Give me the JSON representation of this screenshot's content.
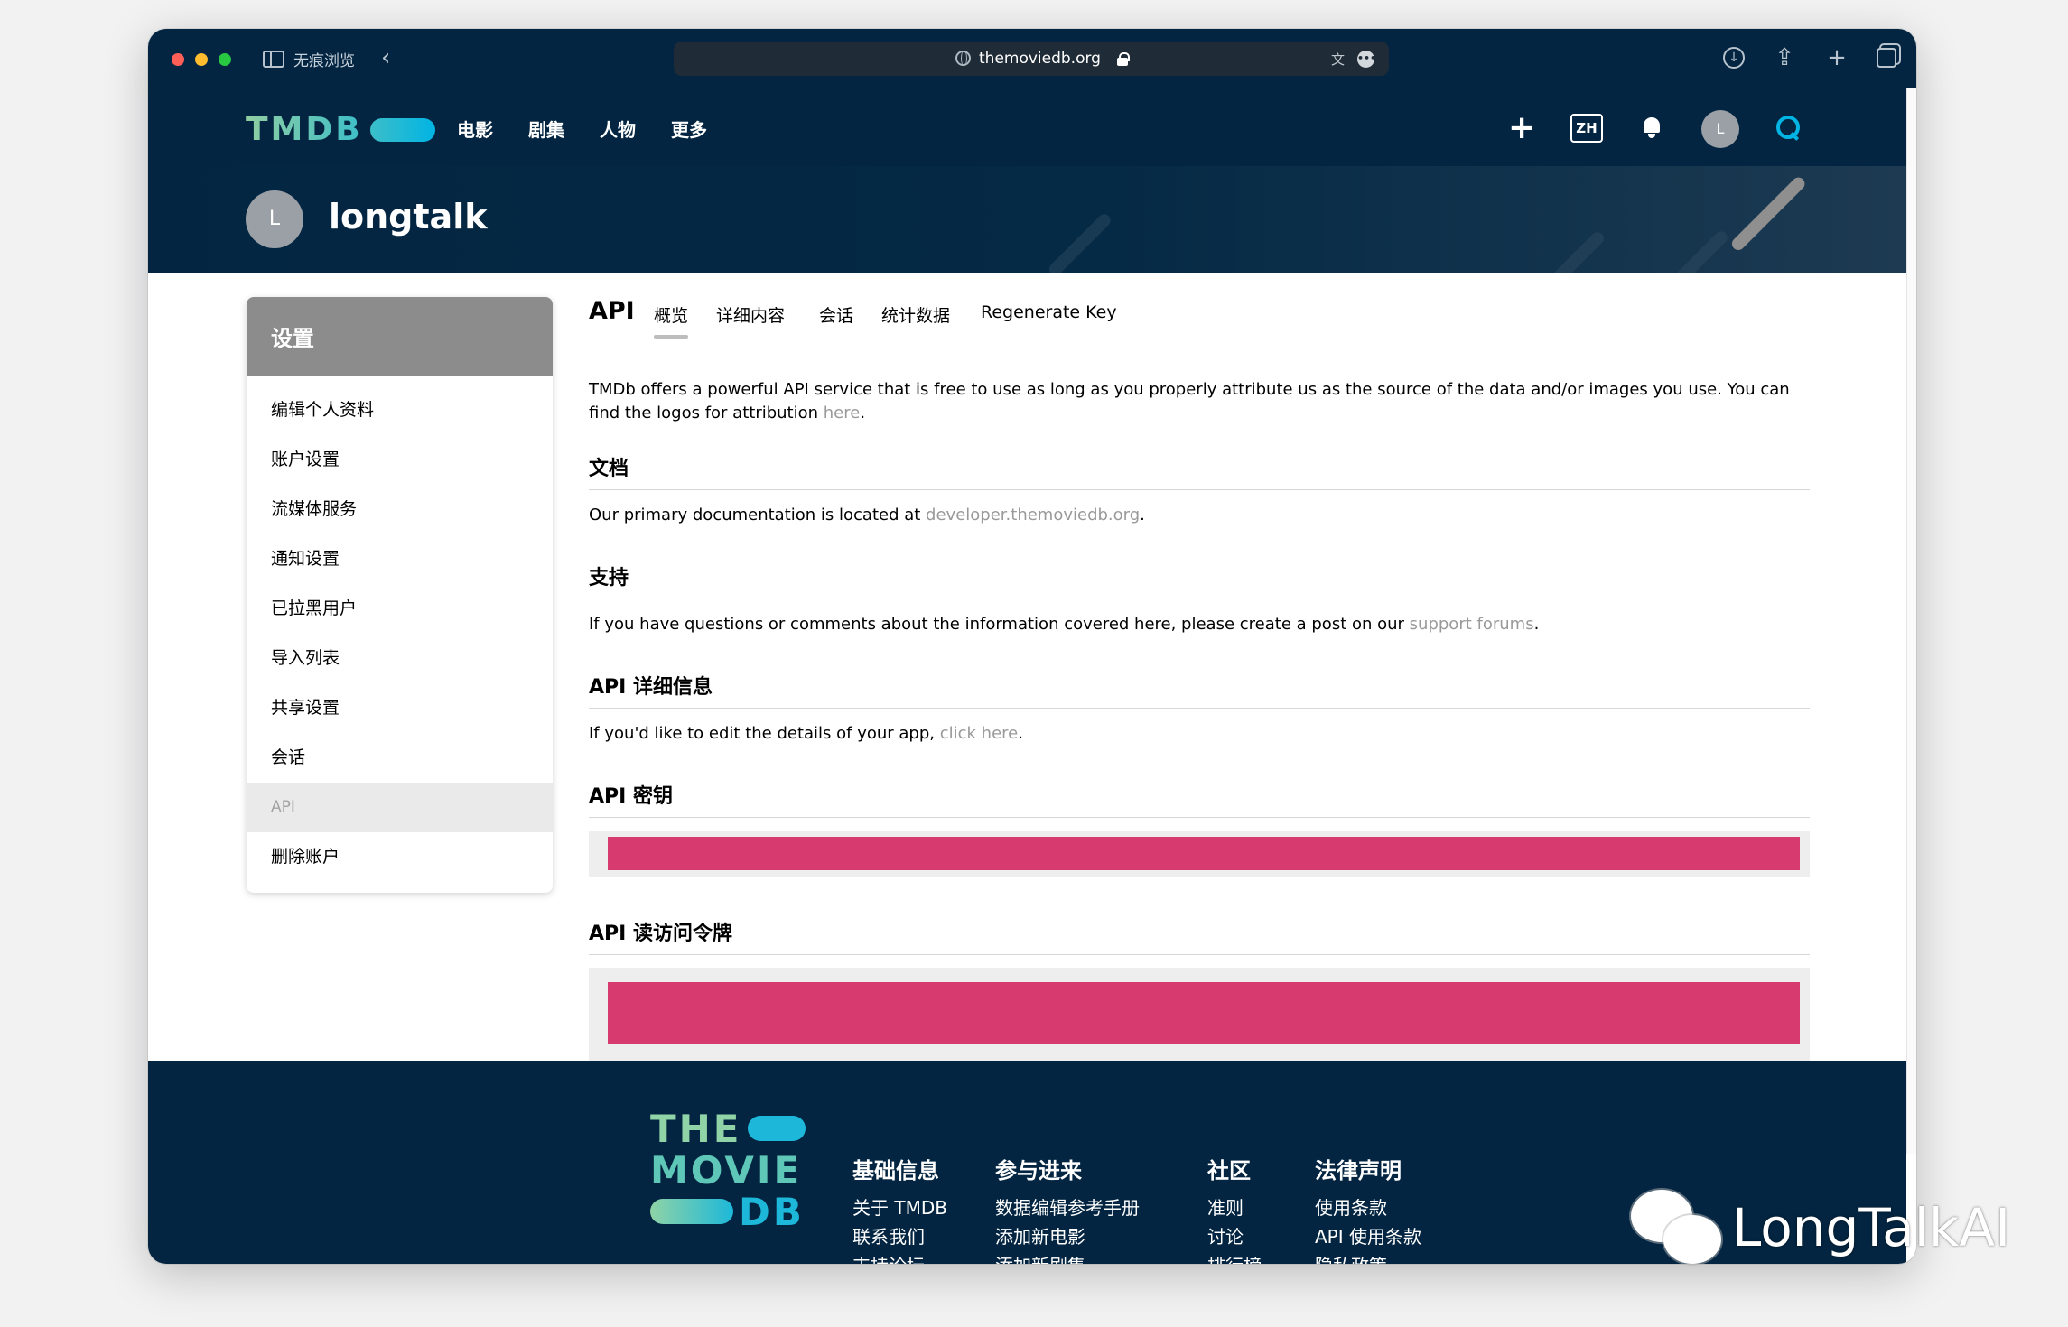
{
  "browser": {
    "tab_label": "无痕浏览",
    "url": "themoviedb.org",
    "light_colors": [
      "#ff5f57",
      "#febc2e",
      "#28c840"
    ]
  },
  "nav": {
    "logo": "TMDB",
    "menu": [
      "电影",
      "剧集",
      "人物",
      "更多"
    ],
    "lang": "ZH",
    "avatar_letter": "L"
  },
  "profile": {
    "avatar_letter": "L",
    "username": "longtalk"
  },
  "sidebar": {
    "title": "设置",
    "items": [
      "编辑个人资料",
      "账户设置",
      "流媒体服务",
      "通知设置",
      "已拉黑用户",
      "导入列表",
      "共享设置",
      "会话",
      "API",
      "删除账户"
    ]
  },
  "main": {
    "title": "API",
    "tabs": [
      "概览",
      "详细内容",
      "会话",
      "统计数据",
      "Regenerate Key"
    ],
    "intro": "TMDb offers a powerful API service that is free to use as long as you properly attribute us as the source of the data and/or images you use. You can find the logos for attribution ",
    "intro_link": "here",
    "docs": {
      "title": "文档",
      "text": "Our primary documentation is located at ",
      "link": "developer.themoviedb.org"
    },
    "support": {
      "title": "支持",
      "text": "If you have questions or comments about the information covered here, please create a post on our ",
      "link": "support forums"
    },
    "details": {
      "title": "API 详细信息",
      "text": "If you'd like to edit the details of your app, ",
      "link": "click here"
    },
    "key": {
      "title": "API 密钥"
    },
    "token": {
      "title": "API 读访问令牌"
    },
    "redact_color": "#d63a6e"
  },
  "footer": {
    "logo": [
      "THE",
      "MOVIE",
      "DB"
    ],
    "columns": [
      {
        "title": "基础信息",
        "links": [
          "关于 TMDB",
          "联系我们",
          "支持论坛"
        ]
      },
      {
        "title": "参与进来",
        "links": [
          "数据编辑参考手册",
          "添加新电影",
          "添加新剧集"
        ]
      },
      {
        "title": "社区",
        "links": [
          "准则",
          "讨论",
          "排行榜"
        ]
      },
      {
        "title": "法律声明",
        "links": [
          "使用条款",
          "API 使用条款",
          "隐私政策"
        ]
      }
    ]
  },
  "watermark": "LongTalkAI"
}
